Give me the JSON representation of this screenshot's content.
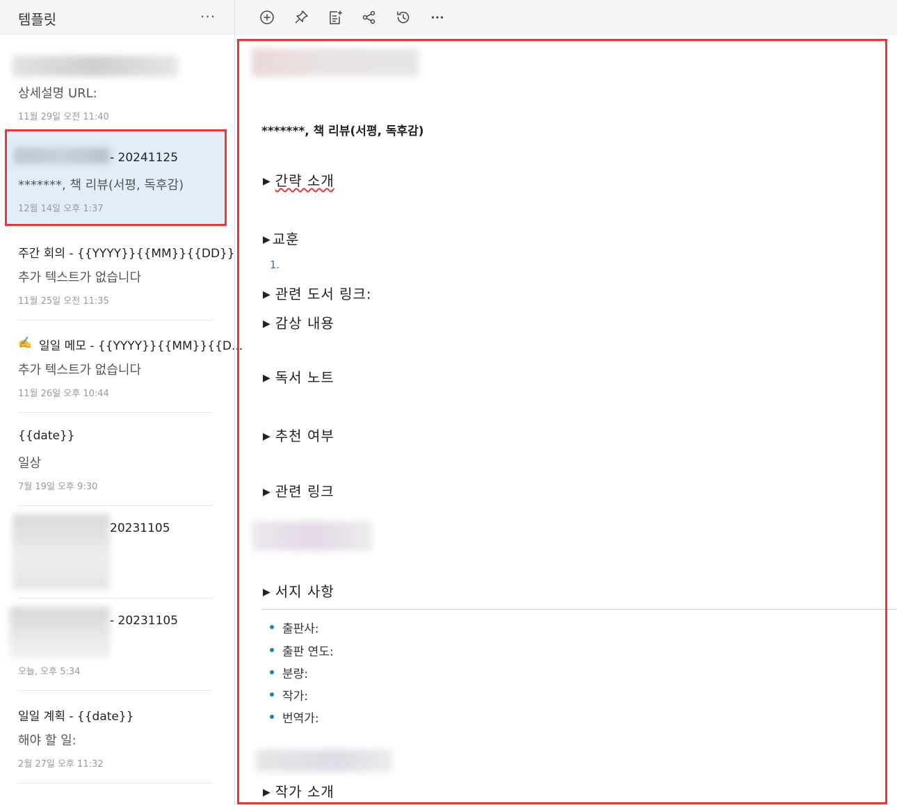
{
  "sidebar": {
    "title": "템플릿",
    "more": "···",
    "notes": [
      {
        "body": "상세설명 URL:",
        "date": "11월 29일 오전 11:40"
      },
      {
        "title_suffix": "- 20241125",
        "body": "*******, 책 리뷰(서평, 독후감)",
        "date": "12월 14일 오후 1:37"
      },
      {
        "title": "주간 회의 - {{YYYY}}{{MM}}{{DD}}",
        "body": "추가 텍스트가 없습니다",
        "date": "11월 25일 오전 11:35"
      },
      {
        "emoji": "✍️",
        "title": "일일 메모 - {{YYYY}}{{MM}}{{D...",
        "body": "추가 텍스트가 없습니다",
        "date": "11월 26일 오후 10:44"
      },
      {
        "title": "{{date}}",
        "body": "일상",
        "date": "7월 19일 오후 9:30"
      },
      {
        "title_suffix": "20231105"
      },
      {
        "title_suffix": "- 20231105",
        "date": "오늘, 오후 5:34"
      },
      {
        "title": "일일 계획 - {{date}}",
        "body": "해야 할 일:",
        "date": "2월 27일 오후 11:32"
      }
    ]
  },
  "toolbar": {
    "icons": [
      "add-circle-icon",
      "pin-icon",
      "add-note-icon",
      "share-icon",
      "history-icon",
      "more-icon"
    ],
    "more": "···"
  },
  "editor": {
    "heading": "*******, 책 리뷰(서평, 독후감)",
    "toggles": {
      "intro": "간략 소개",
      "lesson": "교훈",
      "list_num": "1.",
      "related_books": "관련 도서 링크:",
      "impressions": "감상 내용",
      "reading_notes": "독서 노트",
      "recommend": "추천 여부",
      "related_links": "관련 링크",
      "bib_info": "서지 사항",
      "author_intro": "작가 소개"
    },
    "bullets": [
      "출판사:",
      "출판 연도:",
      "분량:",
      "작가:",
      "번역가:"
    ]
  },
  "colors": {
    "accent": "#2b7bc0",
    "selected_bg": "#e1eefa",
    "highlight_frame": "#e53935"
  }
}
